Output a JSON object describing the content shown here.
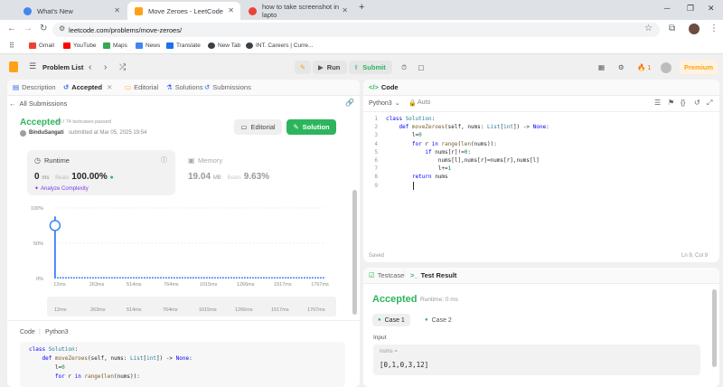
{
  "browser": {
    "tabs": [
      {
        "title": "What's New"
      },
      {
        "title": "Move Zeroes - LeetCode"
      },
      {
        "title": "how to take screenshot in lapto"
      }
    ],
    "new_tab_symbol": "+",
    "url": "leetcode.com/problems/move-zeroes/",
    "bookmarks": [
      "Gmail",
      "YouTube",
      "Maps",
      "News",
      "Translate",
      "New Tab",
      "INT. Careers | Curre..."
    ]
  },
  "lc_nav": {
    "problem_list": "Problem List",
    "run": "Run",
    "submit": "Submit",
    "streak": "1",
    "premium": "Premium"
  },
  "left_panel": {
    "tabs": [
      "Description",
      "Accepted",
      "Editorial",
      "Solutions",
      "Submissions"
    ],
    "back_label": "All Submissions",
    "status": "Accepted",
    "testcases": "74 / 74 testcases passed",
    "user": "BinduSangati",
    "submitted_at": "submitted at Mar 05, 2025 19:54",
    "editorial_btn": "Editorial",
    "solution_btn": "Solution",
    "runtime": {
      "label": "Runtime",
      "value": "0",
      "unit": "ms",
      "beats_label": "Beats",
      "beats": "100.00%"
    },
    "analyze": "Analyze Complexity",
    "memory": {
      "label": "Memory",
      "value": "19.04",
      "unit": "MB",
      "beats_label": "Beats",
      "beats": "9.63%"
    },
    "code_label": "Code",
    "code_lang": "Python3",
    "code_preview": [
      "class Solution:",
      "    def moveZeroes(self, nums: List[int]) -> None:",
      "        l=0",
      "        for r in range(len(nums)):"
    ]
  },
  "chart_data": {
    "type": "bar",
    "title": "",
    "xlabel": "",
    "ylabel": "",
    "y_ticks": [
      "100%",
      "50%",
      "0%"
    ],
    "ylim": [
      0,
      100
    ],
    "x_ticks": [
      "12ms",
      "263ms",
      "514ms",
      "764ms",
      "1015ms",
      "1266ms",
      "1517ms",
      "1767ms"
    ],
    "series": [
      {
        "values": [
          88,
          2,
          2,
          2,
          2,
          2,
          2,
          2,
          2,
          2,
          2,
          2,
          2,
          2,
          2,
          2,
          2,
          2,
          2,
          2,
          2,
          2,
          2,
          2,
          2,
          2,
          2,
          2,
          2,
          2,
          2,
          2,
          2,
          2,
          2,
          2,
          2,
          2,
          2,
          2,
          2,
          2,
          2,
          2,
          2,
          2,
          2,
          2,
          2,
          2,
          2,
          2,
          2,
          2,
          2,
          2,
          2,
          2,
          2,
          2,
          2,
          2,
          2,
          2,
          2,
          2,
          2,
          2,
          2,
          2,
          2,
          2,
          2,
          2,
          2,
          2,
          2,
          2,
          2,
          2,
          2,
          2,
          2,
          2,
          2,
          2,
          2,
          2,
          2,
          2,
          2,
          2,
          2,
          2,
          2,
          2,
          2,
          2,
          2,
          2
        ]
      }
    ],
    "highlight_index": 0,
    "grid": true
  },
  "code_panel": {
    "title": "Code",
    "lang": "Python3",
    "auto": "Auto",
    "lines": [
      "class Solution:",
      "    def moveZeroes(self, nums: List[int]) -> None:",
      "        l=0",
      "        for r in range(len(nums)):",
      "            if nums[r]!=0:",
      "                nums[l],nums[r]=nums[r],nums[l]",
      "                l+=1",
      "        return nums",
      ""
    ],
    "saved": "Saved",
    "cursor": "Ln 9, Col 9"
  },
  "test_panel": {
    "tab_testcase": "Testcase",
    "tab_result": "Test Result",
    "status": "Accepted",
    "runtime": "Runtime: 0 ms",
    "cases": [
      "Case 1",
      "Case 2"
    ],
    "input_label": "Input",
    "var_name": "nums =",
    "var_value": "[0,1,0,3,12]"
  },
  "colors": {
    "accent_green": "#2db55d",
    "orange": "#ffa116",
    "premium": "#ffa116",
    "bar_blue": "#3b82f6"
  }
}
